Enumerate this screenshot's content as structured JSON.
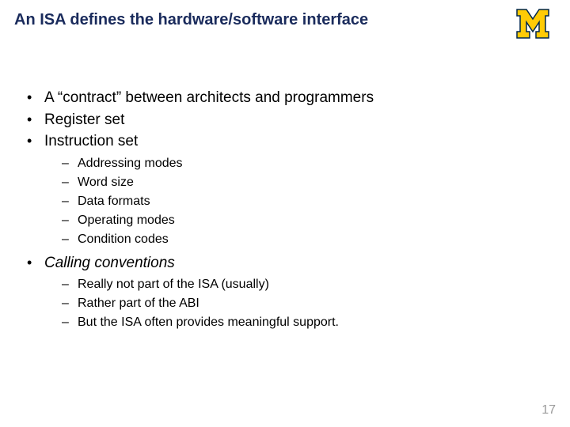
{
  "title": "An ISA defines the hardware/software interface",
  "logo": {
    "name": "michigan-block-m"
  },
  "bullets": [
    {
      "text": "A “contract” between architects and programmers",
      "italic": false,
      "sub": []
    },
    {
      "text": "Register set",
      "italic": false,
      "sub": []
    },
    {
      "text": "Instruction set",
      "italic": false,
      "sub": [
        "Addressing modes",
        "Word size",
        "Data formats",
        "Operating modes",
        "Condition codes"
      ]
    },
    {
      "text": "Calling conventions",
      "italic": true,
      "sub": [
        "Really not part of the ISA (usually)",
        "Rather part of the ABI",
        "But the ISA often provides meaningful support."
      ]
    }
  ],
  "page_number": "17"
}
